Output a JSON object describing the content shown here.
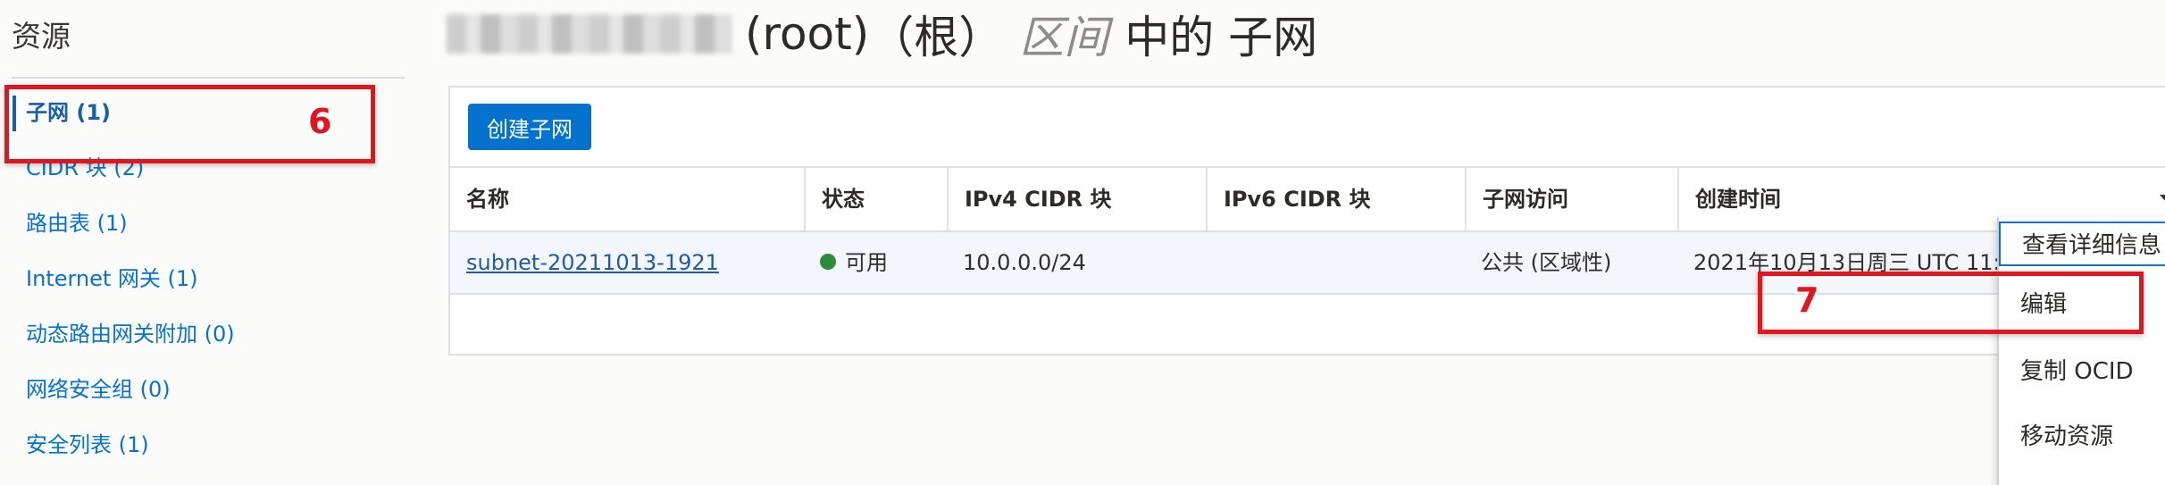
{
  "sidebar": {
    "title": "资源",
    "items": [
      {
        "label": "子网 (1)",
        "active": true
      },
      {
        "label": "CIDR 块 (2)"
      },
      {
        "label": "路由表 (1)"
      },
      {
        "label": "Internet 网关 (1)"
      },
      {
        "label": "动态路由网关附加 (0)"
      },
      {
        "label": "网络安全组 (0)"
      },
      {
        "label": "安全列表 (1)"
      }
    ]
  },
  "header": {
    "root": "(root)",
    "root_cn": "（根）",
    "compartment": "区间",
    "suffix": "中的 子网"
  },
  "toolbar": {
    "create_label": "创建子网"
  },
  "table": {
    "columns": [
      "名称",
      "状态",
      "IPv4 CIDR 块",
      "IPv6 CIDR 块",
      "子网访问",
      "创建时间"
    ],
    "rows": [
      {
        "name": "subnet-20211013-1921",
        "status": "可用",
        "ipv4": "10.0.0.0/24",
        "ipv6": "",
        "access": "公共 (区域性)",
        "created": "2021年10月13日周三 UTC 11:3"
      }
    ]
  },
  "context_menu": {
    "items": [
      "查看详细信息",
      "编辑",
      "复制 OCID",
      "移动资源"
    ]
  },
  "annotations": {
    "step6": "6",
    "step7": "7"
  },
  "colors": {
    "accent": "#0572ce",
    "annotation": "#e3141b",
    "status_available": "#2f8a3a"
  }
}
